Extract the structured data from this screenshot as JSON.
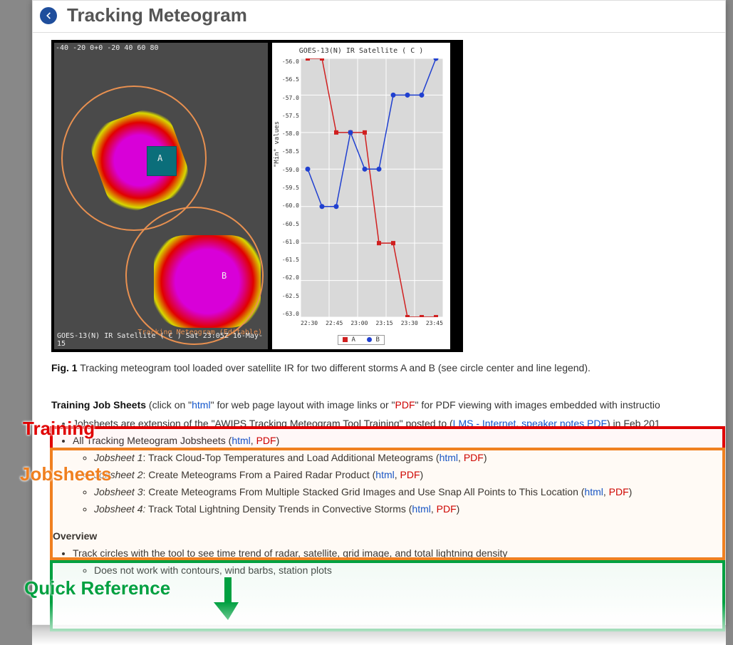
{
  "header": {
    "title": "Tracking Meteogram"
  },
  "figure": {
    "sat_top_label": "-40  -20  0+0  -20  40 60 80",
    "sat_mid_label": "Tracking Meteogram (Editable)",
    "sat_bottom_label": "GOES-13(N) IR Satellite ( C )   Sat 23:05Z 16-May-15",
    "marker_A": "A",
    "marker_B": "B",
    "caption_bold": "Fig. 1",
    "caption_text": " Tracking meteogram tool loaded over satellite IR for two different storms A and B (see circle center and line legend)."
  },
  "chart_data": {
    "type": "line",
    "title": "GOES-13(N) IR Satellite ( C )",
    "ylabel": "\"Min\" values",
    "xlabel": "",
    "categories": [
      "22:30",
      "22:45",
      "23:00",
      "23:15",
      "23:30",
      "23:45"
    ],
    "ylim": [
      -63.0,
      -56.0
    ],
    "yticks": [
      -56.0,
      -56.5,
      -57.0,
      -57.5,
      -58.0,
      -58.5,
      -59.0,
      -59.5,
      -60.0,
      -60.5,
      -61.0,
      -61.5,
      -62.0,
      -62.5,
      -63.0
    ],
    "series": [
      {
        "name": "A",
        "color": "#d02020",
        "marker": "square",
        "values": [
          -56.0,
          -56.0,
          -58.0,
          -58.0,
          -58.0,
          -61.0,
          -61.0,
          -63.0,
          -63.0,
          -63.0
        ]
      },
      {
        "name": "B",
        "color": "#2040d0",
        "marker": "circle",
        "values": [
          -59.0,
          -60.0,
          -60.0,
          -58.0,
          -59.0,
          -59.0,
          -57.0,
          -57.0,
          -57.0,
          -56.0
        ]
      }
    ],
    "legend": "A   B"
  },
  "training": {
    "head_bold": "Training Job Sheets",
    "head_text": " (click on \"",
    "head_html": "html",
    "head_text2": "\" for web page layout with image links or \"",
    "head_pdf": "PDF",
    "head_text3": "\" for PDF viewing with images embedded with instructio",
    "bullets": {
      "b0a": "Jobsheets are extension of the \"AWIPS Tracking Meteogram Tool Training\" posted to (",
      "b0_lms": "LMS - Internet",
      "b0_sep": ", ",
      "b0_spk": "speaker notes PDF",
      "b0b": ") in Feb 201",
      "b1a": "All Tracking Meteogram Jobsheets (",
      "html": "html",
      "comma": ", ",
      "pdf": "PDF",
      "close": ")",
      "js1_i": "Jobsheet 1",
      "js1": ": Track Cloud-Top Temperatures and Load Additional Meteograms (",
      "js2_i": "Jobsheet 2",
      "js2": ": Create Meteograms From a Paired Radar Product (",
      "js3_i": "Jobsheet 3",
      "js3": ": Create Meteograms From Multiple Stacked Grid Images and Use Snap All Points to This Location (",
      "js4_i": "Jobsheet 4:",
      "js4": " Track Total Lightning Density Trends in Convective Storms ("
    }
  },
  "overview": {
    "title": "Overview",
    "b1": "Track circles with the tool to see time trend of radar, satellite, grid image, and total lightning density",
    "b2": "Does not work with contours, wind barbs, station plots"
  },
  "annotations": {
    "training": "Training",
    "jobsheets": "Jobsheets",
    "quickref": "Quick Reference"
  }
}
